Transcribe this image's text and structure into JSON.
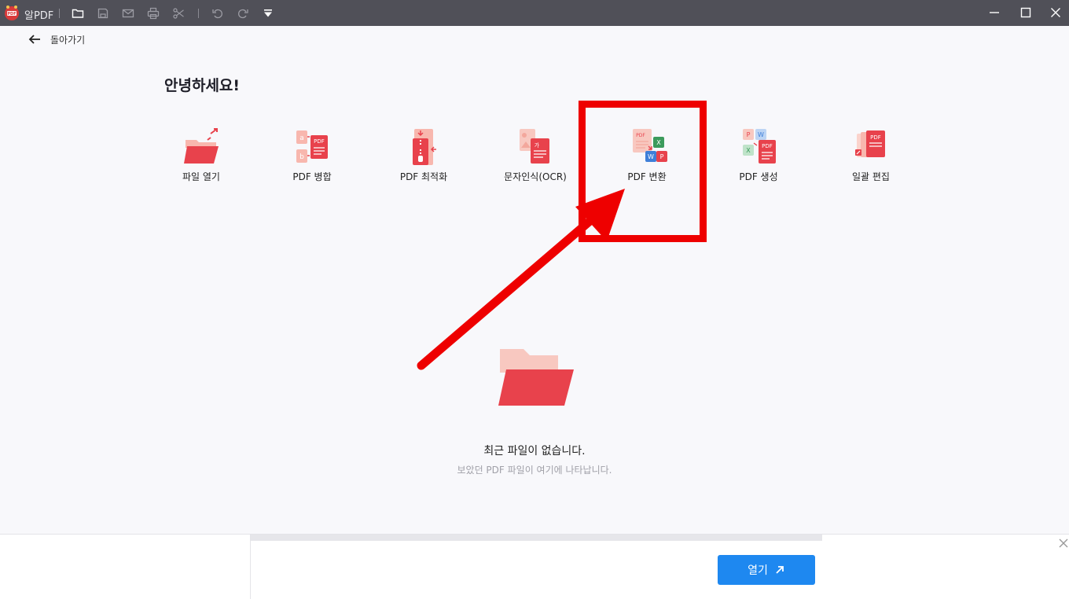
{
  "app": {
    "name": "알PDF",
    "title_icons": [
      "open-folder-icon",
      "save-icon",
      "mail-icon",
      "print-icon",
      "scissors-icon",
      "undo-icon",
      "redo-icon",
      "dropdown-icon"
    ],
    "window_controls": [
      "minimize-icon",
      "maximize-icon",
      "close-icon"
    ]
  },
  "nav": {
    "back_label": "돌아가기"
  },
  "greeting": "안녕하세요!",
  "tools": [
    {
      "label": "파일 열기",
      "icon": "open-file-icon"
    },
    {
      "label": "PDF 병합",
      "icon": "merge-pdf-icon"
    },
    {
      "label": "PDF 최적화",
      "icon": "compress-pdf-icon"
    },
    {
      "label": "문자인식(OCR)",
      "icon": "ocr-icon"
    },
    {
      "label": "PDF 변환",
      "icon": "convert-pdf-icon"
    },
    {
      "label": "PDF 생성",
      "icon": "create-pdf-icon"
    },
    {
      "label": "일괄 편집",
      "icon": "batch-edit-icon"
    }
  ],
  "empty_state": {
    "title": "최근 파일이 없습니다.",
    "subtitle": "보았던 PDF 파일이 여기에 나타납니다."
  },
  "ad": {
    "open_label": "열기"
  },
  "colors": {
    "accent": "#e8424c",
    "highlight": "#ee0000",
    "button": "#1e88f0",
    "titlebar": "#505058"
  }
}
